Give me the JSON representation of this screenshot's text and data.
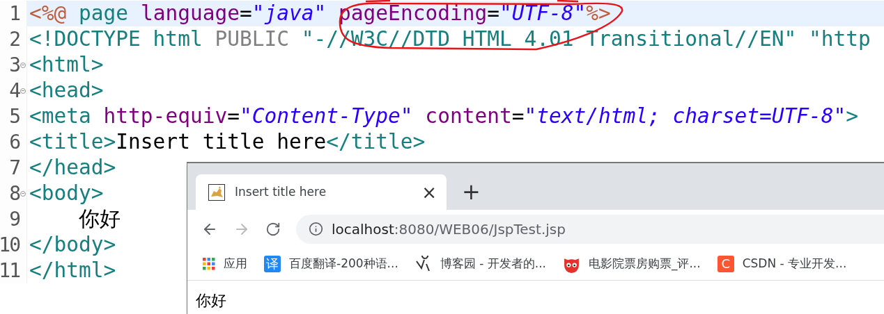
{
  "editor": {
    "lines": [
      {
        "number": "1",
        "current": true,
        "foldable": false,
        "tokens": [
          {
            "text": "<%@",
            "kind": "directive"
          },
          {
            "text": " page ",
            "kind": "tag"
          },
          {
            "text": "language",
            "kind": "attr"
          },
          {
            "text": "=",
            "kind": "plain"
          },
          {
            "text": "\"java\"",
            "kind": "string"
          },
          {
            "text": " pageEncoding",
            "kind": "attr"
          },
          {
            "text": "=",
            "kind": "plain"
          },
          {
            "text": "\"UTF-8\"",
            "kind": "string"
          },
          {
            "text": "%>",
            "kind": "directive"
          }
        ]
      },
      {
        "number": "2",
        "current": false,
        "foldable": false,
        "tokens": [
          {
            "text": "<!DOCTYPE html ",
            "kind": "tag"
          },
          {
            "text": "PUBLIC",
            "kind": "doctype"
          },
          {
            "text": " \"-//W3C//DTD HTML 4.01 Transitional//EN\" \"http",
            "kind": "tag"
          }
        ]
      },
      {
        "number": "3",
        "current": false,
        "foldable": true,
        "tokens": [
          {
            "text": "<html>",
            "kind": "tag"
          }
        ]
      },
      {
        "number": "4",
        "current": false,
        "foldable": true,
        "tokens": [
          {
            "text": "<head>",
            "kind": "tag"
          }
        ]
      },
      {
        "number": "5",
        "current": false,
        "foldable": false,
        "tokens": [
          {
            "text": "<meta ",
            "kind": "tag"
          },
          {
            "text": "http-equiv",
            "kind": "attr"
          },
          {
            "text": "=",
            "kind": "plain"
          },
          {
            "text": "\"Content-Type\"",
            "kind": "string"
          },
          {
            "text": " content",
            "kind": "attr"
          },
          {
            "text": "=",
            "kind": "plain"
          },
          {
            "text": "\"text/html; charset=UTF-8\"",
            "kind": "string"
          },
          {
            "text": ">",
            "kind": "tag"
          }
        ]
      },
      {
        "number": "6",
        "current": false,
        "foldable": false,
        "tokens": [
          {
            "text": "<title>",
            "kind": "tag"
          },
          {
            "text": "Insert title here",
            "kind": "plain"
          },
          {
            "text": "</title>",
            "kind": "tag"
          }
        ]
      },
      {
        "number": "7",
        "current": false,
        "foldable": false,
        "tokens": [
          {
            "text": "</head>",
            "kind": "tag"
          }
        ]
      },
      {
        "number": "8",
        "current": false,
        "foldable": true,
        "tokens": [
          {
            "text": "<body>",
            "kind": "tag"
          }
        ]
      },
      {
        "number": "9",
        "current": false,
        "foldable": false,
        "tokens": [
          {
            "text": "    你好",
            "kind": "plain"
          }
        ]
      },
      {
        "number": "10",
        "current": false,
        "foldable": false,
        "tokens": [
          {
            "text": "</body>",
            "kind": "tag"
          }
        ]
      },
      {
        "number": "11",
        "current": false,
        "foldable": false,
        "tokens": [
          {
            "text": "</html>",
            "kind": "tag"
          }
        ]
      }
    ]
  },
  "browser": {
    "tab": {
      "title": "Insert title here",
      "close": "×",
      "new_tab": "+"
    },
    "address": {
      "host": "localhost",
      "path": ":8080/WEB06/JspTest.jsp"
    },
    "bookmarks": [
      {
        "kind": "apps",
        "label": "应用"
      },
      {
        "kind": "letter",
        "icon_text": "译",
        "color": "#1e88f5",
        "label": "百度翻译-200种语..."
      },
      {
        "kind": "doodle",
        "label": "博客园 - 开发者的..."
      },
      {
        "kind": "cat",
        "color": "#e5312b",
        "label": "电影院票房购票_评..."
      },
      {
        "kind": "letter",
        "icon_text": "C",
        "color": "#fc5531",
        "label": "CSDN - 专业开发..."
      }
    ],
    "content": "你好"
  }
}
